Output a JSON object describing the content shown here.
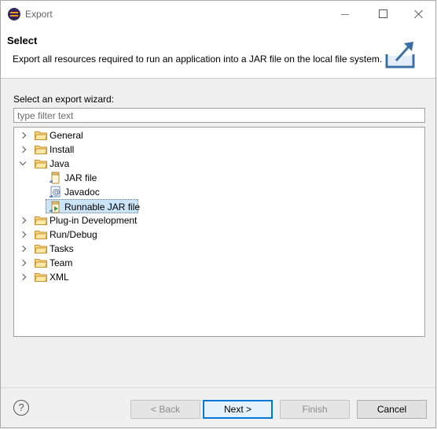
{
  "window": {
    "title": "Export"
  },
  "banner": {
    "title": "Select",
    "description": "Export all resources required to run an application into a JAR file on the local file system."
  },
  "wizard": {
    "label": "Select an export wizard:",
    "filter_placeholder": "type filter text",
    "filter_value": ""
  },
  "tree": {
    "items": [
      {
        "label": "General",
        "type": "folder",
        "expanded": false
      },
      {
        "label": "Install",
        "type": "folder",
        "expanded": false
      },
      {
        "label": "Java",
        "type": "folder",
        "expanded": true
      },
      {
        "label": "JAR file",
        "type": "jar-icon"
      },
      {
        "label": "Javadoc",
        "type": "javadoc-icon"
      },
      {
        "label": "Runnable JAR file",
        "type": "runnable-jar-icon",
        "selected": true
      },
      {
        "label": "Plug-in Development",
        "type": "folder",
        "expanded": false
      },
      {
        "label": "Run/Debug",
        "type": "folder",
        "expanded": false
      },
      {
        "label": "Tasks",
        "type": "folder",
        "expanded": false
      },
      {
        "label": "Team",
        "type": "folder",
        "expanded": false
      },
      {
        "label": "XML",
        "type": "folder",
        "expanded": false
      }
    ]
  },
  "footer": {
    "help_symbol": "?",
    "back_label": "< Back",
    "next_label": "Next >",
    "finish_label": "Finish",
    "cancel_label": "Cancel"
  },
  "colors": {
    "selection": "#cce4f7",
    "folder": "#e8b54c",
    "default_button_border": "#0078d7"
  }
}
